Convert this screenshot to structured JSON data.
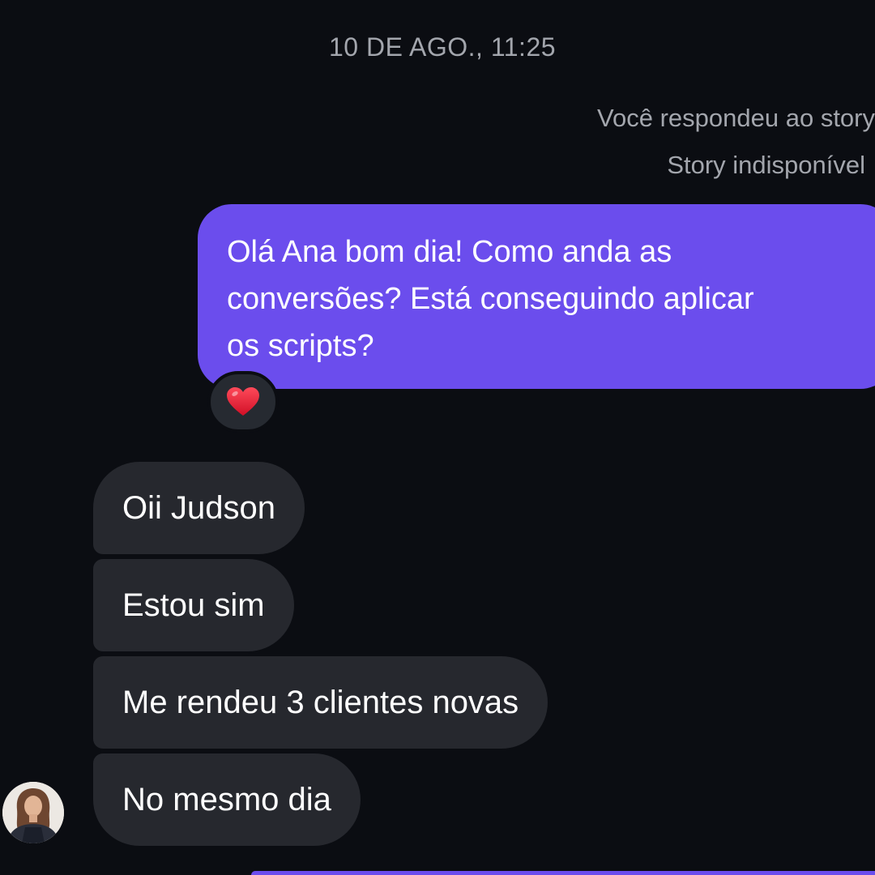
{
  "chat": {
    "timestamp": "10 DE AGO., 11:25",
    "story_reply_note": "Você respondeu ao story",
    "story_status": "Story indisponível",
    "sent_message": {
      "lines": [
        "Olá Ana bom dia! Como anda as",
        "conversões? Está conseguindo aplicar",
        "os scripts?"
      ],
      "reaction": "heart-emoji"
    },
    "received_messages": [
      "Oii Judson",
      "Estou sim",
      "Me rendeu 3 clientes novas",
      "No mesmo dia"
    ],
    "contact_avatar": "avatar-photo"
  },
  "colors": {
    "background": "#0b0d12",
    "sent_bubble": "#6b4ded",
    "received_bubble": "#26282e",
    "meta_text": "#a3a6ad",
    "reaction_heart": "#e0142e"
  }
}
